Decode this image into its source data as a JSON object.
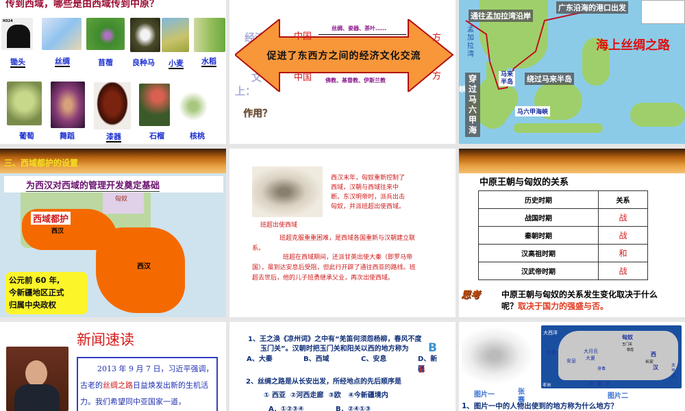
{
  "slide1": {
    "title": "传到西域，哪些是由西域传到中原？",
    "row1": [
      "锄头",
      "丝绸",
      "苜蓿",
      "良种马",
      "小麦",
      "水稻"
    ],
    "row2": [
      "葡萄",
      "舞蹈",
      "漆器",
      "石榴",
      "核桃"
    ],
    "hoe_code": "H324"
  },
  "slide2": {
    "arrow_text": "促进了东西方之间的经济文化交流",
    "top_items": "丝绸、瓷器、茶叶……",
    "bottom_items": "佛教、基督教、伊斯兰教",
    "china": "中国",
    "fang": "方",
    "econ": "经济",
    "culture": "文",
    "shang": "上：",
    "question": "作用？"
  },
  "slide3": {
    "title": "海上丝绸之路",
    "labels": {
      "start": "广东沿海的港口出发",
      "bengal_coast": "通往孟加拉湾沿岸",
      "bengal_bay": "孟加拉湾",
      "malay": "马来半岛",
      "around_malay": "绕过马来半岛",
      "malacca": "马六甲海峡",
      "through": "穿过马六甲海",
      "xia": "峡"
    }
  },
  "slide4": {
    "heading": "三、西域都护的设置",
    "subtitle": "为西汉对西域的管理开发奠定基础",
    "protectorate": "西域都护",
    "xihan1": "西汉",
    "xihan2": "西汉",
    "xiongnu": "匈奴",
    "note": [
      "公元前 60 年,",
      "今新疆地区正式",
      "归属中央政权"
    ]
  },
  "slide5": {
    "side_text": "西汉末年，匈奴重新控制了西域，汉朝与西域往来中断。东汉明帝时，派兵出击匈奴，并派班超出使西域。",
    "caption": "班超出使西域",
    "para1": "班超克服重重困难，是西域各国重新与汉朝建立联系。",
    "para2": "班超在西域期间，还派甘英出使大秦（即罗马帝国），虽到达安息后受阻，但此行开辟了通往西亚的路线。班超去世后，他的儿子班勇继承父业，再次出使西域。"
  },
  "slide6": {
    "title": "中原王朝与匈奴的关系",
    "headers": [
      "历史时期",
      "关系"
    ],
    "rows": [
      [
        "战国时期",
        "战"
      ],
      [
        "秦朝时期",
        "战"
      ],
      [
        "汉高祖时期",
        "和"
      ],
      [
        "汉武帝时期",
        "战"
      ]
    ],
    "think_icon": "思考",
    "question": "中原王朝与匈奴的关系发生变化取决于什么呢？",
    "answer": "取决于国力的强盛与否。"
  },
  "slide7": {
    "title": "新闻速读",
    "text_before": "2013 年 9 月 7 日，习近平强调，古老的",
    "highlight": "丝绸之路",
    "text_after": "日益焕发出新的生机活力。我们希望同中亚国家一道，"
  },
  "slide8": {
    "q1_line1": "1、王之涣《凉州词》之中有“羌笛何须怨杨柳，春风不度",
    "q1_line2": "玉门关”。汉朝时把玉门关和阳关以西的地方称为",
    "q1_answer_big": "B",
    "q1_options": [
      "A、大秦",
      "B、西域",
      "C、安息",
      "D、新疆"
    ],
    "q1_answer": "B",
    "q2": "2、丝绸之路是从长安出发，所经地点的先后顺序是",
    "q2_items": "① 西亚  ②河西走廊  ③欧   ④今新疆境内",
    "q2_options": [
      "A．①②③④",
      "B．②④①③"
    ]
  },
  "slide9": {
    "cap1": "图片一",
    "cap1b": "张骞",
    "cap2": "图片二",
    "question": "1、图片一中的人物出使到的地方称为什么地方？",
    "map_labels": [
      "大西洋",
      "匈奴",
      "大秦",
      "安息",
      "大月氏",
      "大夏",
      "身毒",
      "西",
      "汉",
      "长安",
      "玉门关",
      "敦煌",
      "印度洋",
      "太平洋",
      "非洲"
    ]
  }
}
